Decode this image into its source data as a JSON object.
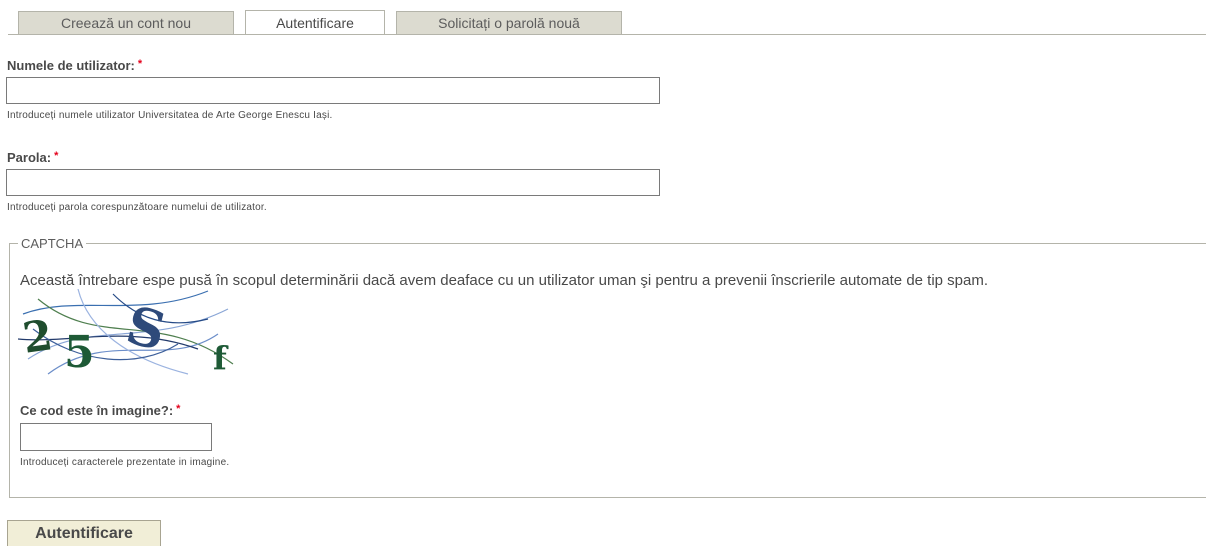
{
  "tabs": [
    {
      "label": "Creează un cont nou",
      "active": false
    },
    {
      "label": "Autentificare",
      "active": true
    },
    {
      "label": "Solicitați o parolă nouă",
      "active": false
    }
  ],
  "username": {
    "label": "Numele de utilizator:",
    "required_mark": "*",
    "value": "",
    "description": "Introduceți numele utilizator Universitatea de Arte George Enescu Iași."
  },
  "password": {
    "label": "Parola:",
    "required_mark": "*",
    "value": "",
    "description": "Introduceți parola corespunzătoare numelui de utilizator."
  },
  "captcha": {
    "legend": "CAPTCHA",
    "explanation": "Această întrebare espe pusă în scopul determinării dacă avem deaface cu un utilizator uman şi pentru a prevenii înscrierile automate de tip spam.",
    "image_text": "25Sf",
    "code_label": "Ce cod este în imagine?:",
    "required_mark": "*",
    "value": "",
    "description": "Introduceți caracterele prezentate in imagine."
  },
  "submit_label": "Autentificare",
  "colors": {
    "required": "#e4001b",
    "tab_bg": "#dcdbd0",
    "button_bg": "#f1eed7",
    "border": "#b4b4aa"
  }
}
